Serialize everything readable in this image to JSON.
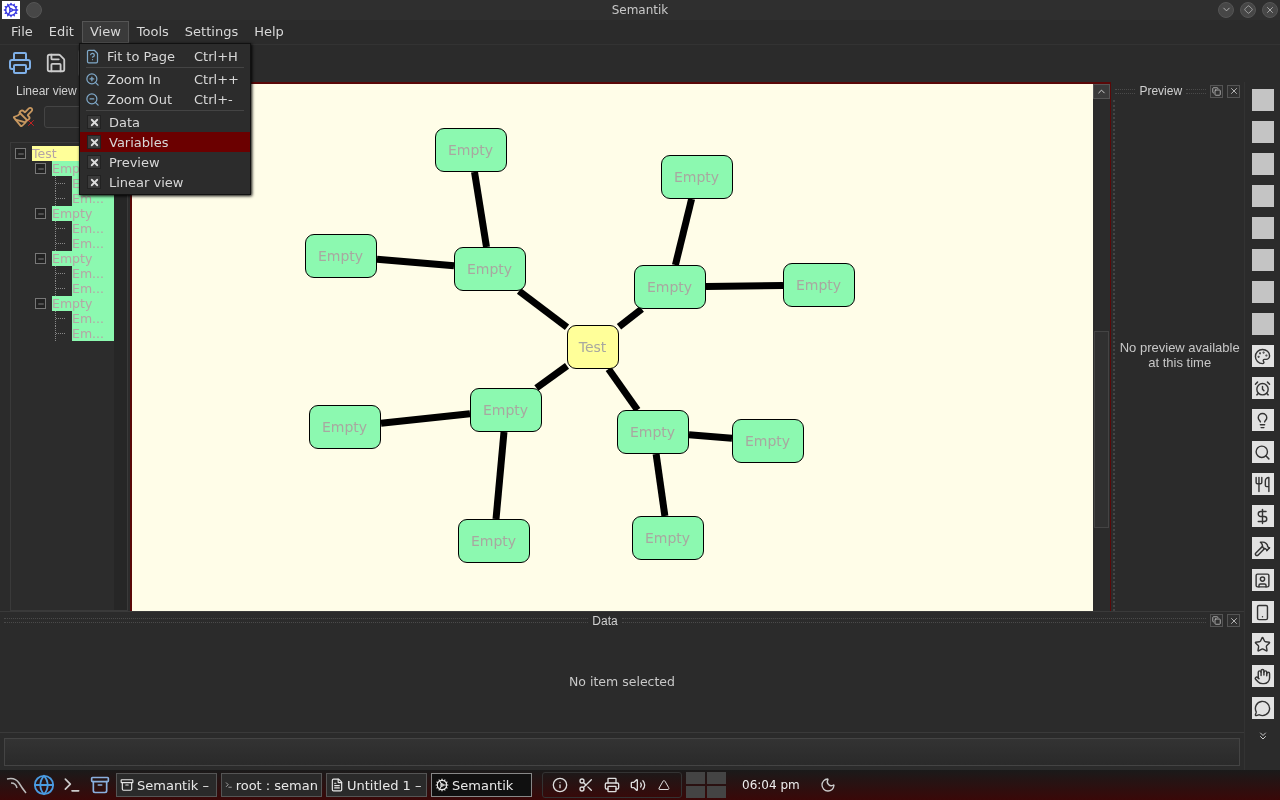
{
  "window": {
    "title": "Semantik"
  },
  "menubar": [
    {
      "label": "File",
      "selected": false
    },
    {
      "label": "Edit",
      "selected": false
    },
    {
      "label": "View",
      "selected": true
    },
    {
      "label": "Tools",
      "selected": false
    },
    {
      "label": "Settings",
      "selected": false
    },
    {
      "label": "Help",
      "selected": false
    }
  ],
  "view_menu": [
    {
      "kind": "action",
      "label": "Fit to Page",
      "shortcut": "Ctrl+H",
      "selected": false
    },
    {
      "kind": "separator"
    },
    {
      "kind": "action",
      "label": "Zoom In",
      "shortcut": "Ctrl++",
      "selected": false
    },
    {
      "kind": "action",
      "label": "Zoom Out",
      "shortcut": "Ctrl+-",
      "selected": false
    },
    {
      "kind": "separator"
    },
    {
      "kind": "toggle",
      "label": "Data",
      "checked": true,
      "selected": false
    },
    {
      "kind": "toggle",
      "label": "Variables",
      "checked": true,
      "selected": true
    },
    {
      "kind": "toggle",
      "label": "Preview",
      "checked": true,
      "selected": false
    },
    {
      "kind": "toggle",
      "label": "Linear view",
      "checked": true,
      "selected": false
    }
  ],
  "linear_view": {
    "title": "Linear view",
    "tree": [
      {
        "label": "Test",
        "expanded": true,
        "children": [
          {
            "label": "Emp",
            "expanded": true,
            "children": [
              {
                "label": "E"
              },
              {
                "label": "Em..."
              }
            ]
          },
          {
            "label": "Empty",
            "expanded": true,
            "children": [
              {
                "label": "Em..."
              },
              {
                "label": "Em..."
              }
            ]
          },
          {
            "label": "Empty",
            "expanded": true,
            "children": [
              {
                "label": "Em..."
              },
              {
                "label": "Em..."
              }
            ]
          },
          {
            "label": "Empty",
            "expanded": true,
            "children": [
              {
                "label": "Em..."
              },
              {
                "label": "Em..."
              }
            ]
          }
        ]
      }
    ]
  },
  "canvas": {
    "nodes": [
      {
        "label": "Empty",
        "color": "#8cf9b0"
      },
      {
        "label": "Empty",
        "color": "#8cf9b0"
      },
      {
        "label": "Empty",
        "color": "#8cf9b0"
      },
      {
        "label": "Empty",
        "color": "#8cf9b0"
      },
      {
        "label": "Empty",
        "color": "#8cf9b0"
      },
      {
        "label": "Empty",
        "color": "#8cf9b0"
      },
      {
        "label": "Test",
        "color": "#ffff99"
      },
      {
        "label": "Empty",
        "color": "#8cf9b0"
      },
      {
        "label": "Empty",
        "color": "#8cf9b0"
      },
      {
        "label": "Empty",
        "color": "#8cf9b0"
      },
      {
        "label": "Empty",
        "color": "#8cf9b0"
      },
      {
        "label": "Empty",
        "color": "#8cf9b0"
      },
      {
        "label": "Empty",
        "color": "#8cf9b0"
      }
    ]
  },
  "preview": {
    "title": "Preview",
    "message": "No preview available at this time"
  },
  "data_dock": {
    "title": "Data",
    "message": "No item selected"
  },
  "taskbar": {
    "tasks": [
      {
        "label": "Semantik –",
        "selected": false
      },
      {
        "label": "root : seman",
        "selected": false
      },
      {
        "label": "Untitled 1 –",
        "selected": false
      },
      {
        "label": "Semantik",
        "selected": true
      }
    ],
    "clock": "06:04 pm"
  }
}
